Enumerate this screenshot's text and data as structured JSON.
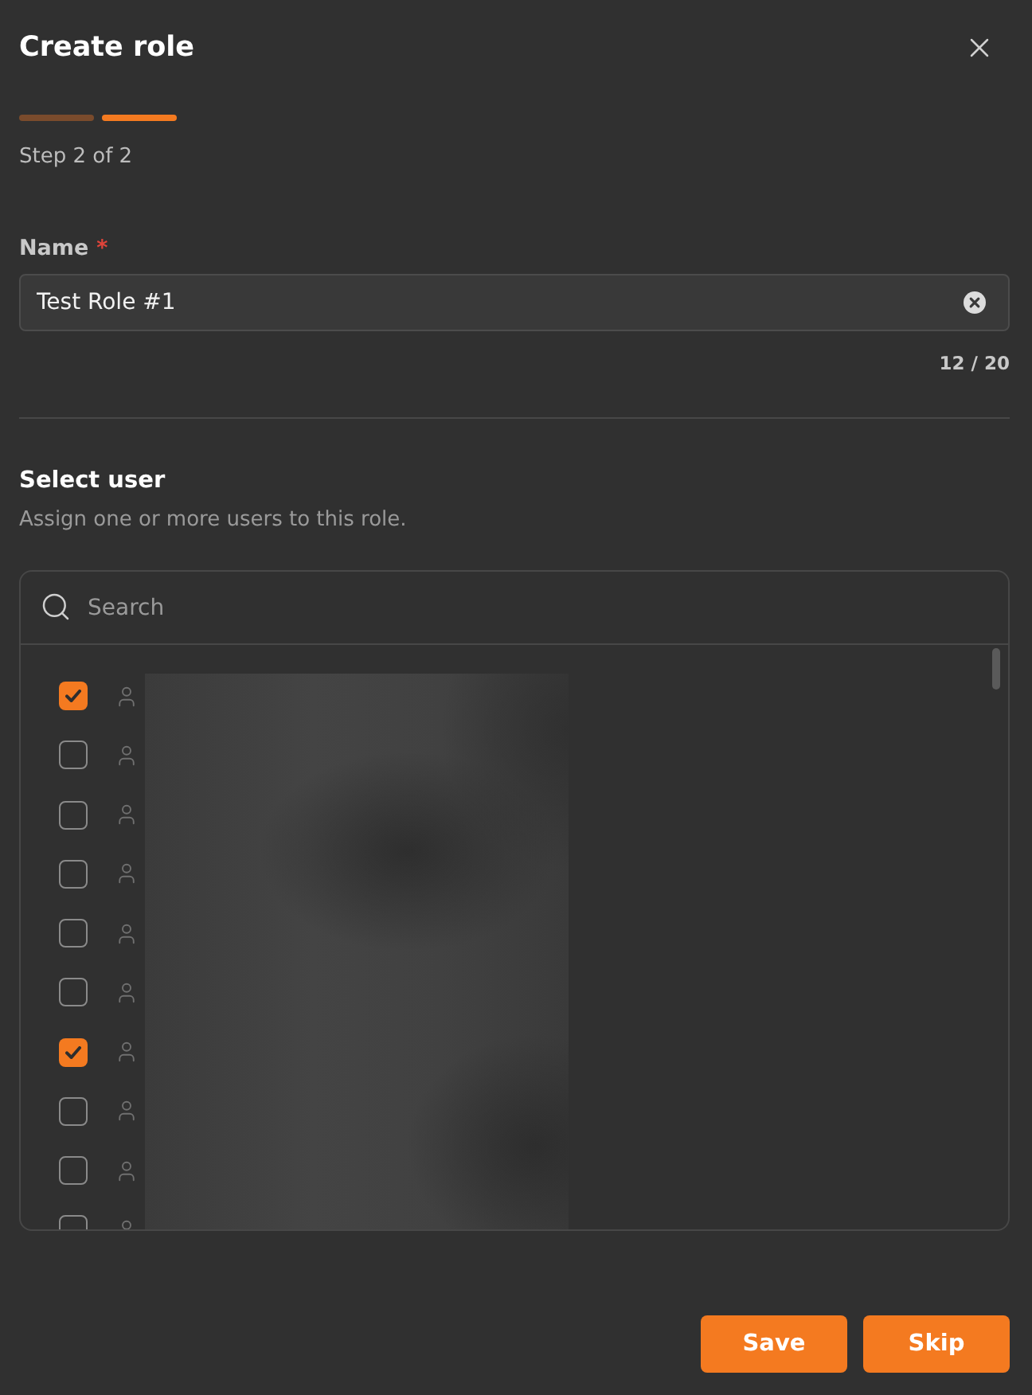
{
  "dialog": {
    "title": "Create role"
  },
  "progress": {
    "steps": [
      {
        "current": false
      },
      {
        "current": true
      }
    ],
    "label": "Step 2 of 2"
  },
  "name_field": {
    "label": "Name",
    "required_mark": "*",
    "value": "Test Role #1",
    "counter": "12 / 20"
  },
  "select_user": {
    "title": "Select user",
    "description": "Assign one or more users to this role.",
    "search": {
      "placeholder": "Search"
    },
    "users": [
      {
        "checked": true
      },
      {
        "checked": false
      },
      {
        "checked": false
      },
      {
        "checked": false
      },
      {
        "checked": false
      },
      {
        "checked": false
      },
      {
        "checked": true
      },
      {
        "checked": false
      },
      {
        "checked": false
      },
      {
        "checked": false
      }
    ]
  },
  "buttons": [
    {
      "label": "Save"
    },
    {
      "label": "Skip"
    }
  ]
}
